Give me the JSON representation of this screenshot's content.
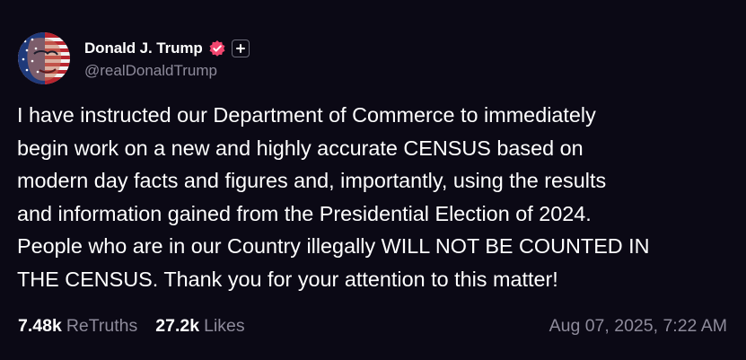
{
  "post": {
    "author": {
      "display_name": "Donald J. Trump",
      "handle": "@realDonaldTrump",
      "verified_icon": "verified-badge-icon",
      "follow_icon": "plus-icon"
    },
    "lines": [
      "I have instructed our Department of Commerce to immediately",
      "begin work on a new and highly accurate CENSUS based on",
      "modern day facts and figures and, importantly, using the results",
      "and information gained from the Presidential Election of 2024.",
      "People who are in our Country illegally WILL NOT BE COUNTED IN",
      "THE CENSUS. Thank you for your attention to this matter!"
    ],
    "stats": {
      "retruths_count": "7.48k",
      "retruths_label": "ReTruths",
      "likes_count": "27.2k",
      "likes_label": "Likes"
    },
    "timestamp": "Aug 07, 2025, 7:22 AM"
  },
  "colors": {
    "background": "#0b0915",
    "text": "#ffffff",
    "muted": "#8e8b9b",
    "verified": "#f2466f"
  }
}
